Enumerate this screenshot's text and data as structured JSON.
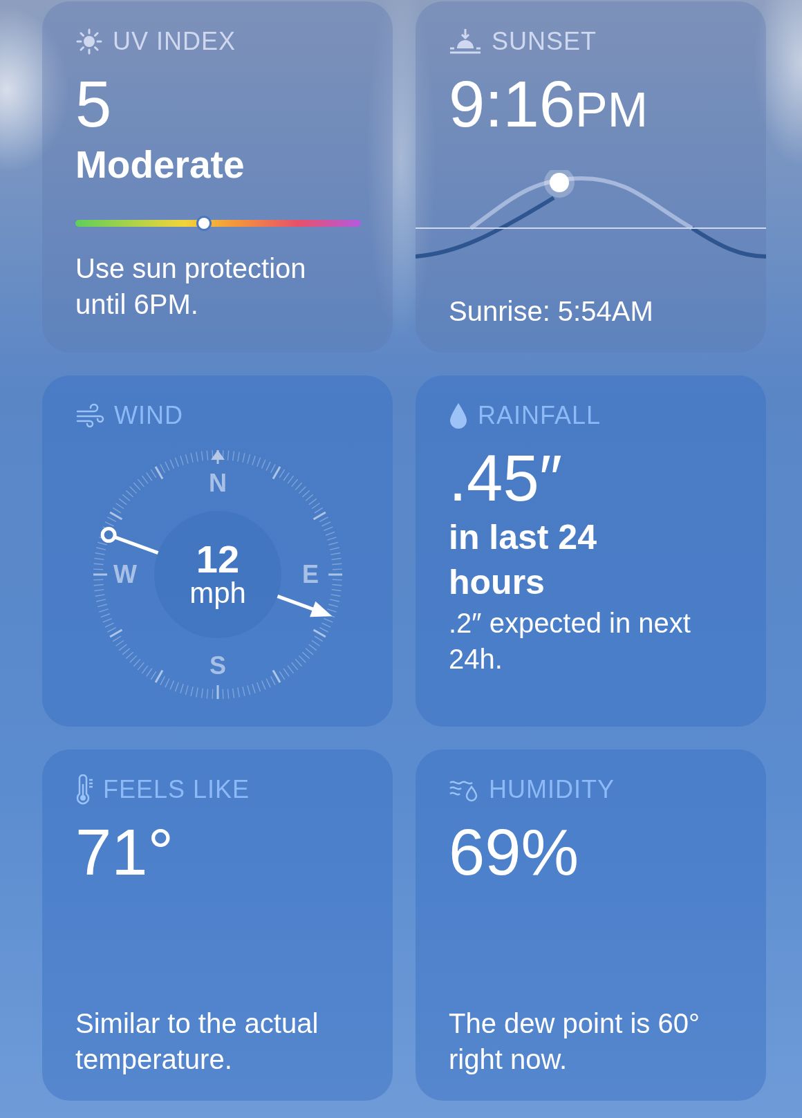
{
  "cards": [
    {
      "kind": "uv",
      "title": "UV INDEX",
      "value": "5",
      "category": "Moderate",
      "level": 0.45,
      "note": "Use sun protection until 6PM."
    },
    {
      "kind": "sunset",
      "title": "SUNSET",
      "value": "9:16",
      "period": "PM",
      "note": "Sunrise: 5:54AM"
    },
    {
      "kind": "wind",
      "title": "WIND",
      "value": "12",
      "unit": "mph",
      "directions": [
        "N",
        "E",
        "S",
        "W"
      ]
    },
    {
      "kind": "rain",
      "title": "RAINFALL",
      "value": ".45″",
      "subtitle": "in last 24 hours",
      "note": ".2″ expected in next 24h."
    },
    {
      "kind": "feels",
      "title": "FEELS LIKE",
      "value": "71°",
      "note": "Similar to the actual temperature."
    },
    {
      "kind": "humidity",
      "title": "HUMIDITY",
      "value": "69%",
      "note": "The dew point is 60° right now."
    }
  ]
}
